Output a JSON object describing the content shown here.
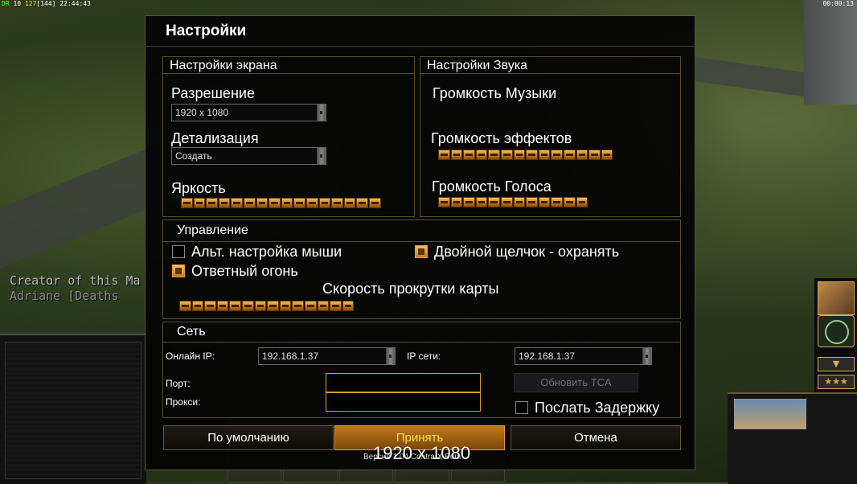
{
  "hud": {
    "fps_label": "DR",
    "fps_value": "10",
    "frame_value": "127",
    "frame_total": "[144]",
    "clock": "22:44:43",
    "game_timer": "00:00:13"
  },
  "background_text": {
    "line1": "Creator of this Ma",
    "line2": "Adriane [Deaths"
  },
  "dialog": {
    "title": "Настройки",
    "screen": {
      "heading": "Настройки экрана",
      "resolution_label": "Разрешение",
      "resolution_value": "1920 x 1080",
      "detail_label": "Детализация",
      "detail_value": "Создать",
      "brightness_label": "Яркость",
      "brightness_segments": 16
    },
    "sound": {
      "heading": "Настройки Звука",
      "music_label": "Громкость Музыки",
      "music_segments": 0,
      "effects_label": "Громкость эффектов",
      "effects_segments": 14,
      "voice_label": "Громкость Голоса",
      "voice_segments": 12
    },
    "control": {
      "heading": "Управление",
      "alt_mouse_label": "Альт. настройка мыши",
      "alt_mouse_checked": false,
      "double_click_label": "Двойной щелчок - охранять",
      "double_click_checked": true,
      "return_fire_label": "Ответный огонь",
      "return_fire_checked": true,
      "scroll_speed_label": "Скорость прокрутки карты",
      "scroll_speed_segments": 14
    },
    "network": {
      "heading": "Сеть",
      "online_ip_label": "Онлайн IP:",
      "online_ip_value": "192.168.1.37",
      "lan_ip_label": "IP сети:",
      "lan_ip_value": "192.168.1.37",
      "port_label": "Порт:",
      "port_value": "",
      "proxy_label": "Прокси:",
      "proxy_value": "",
      "update_button": "Обновить TCA",
      "send_delay_label": "Послать Задержку",
      "send_delay_checked": false
    },
    "buttons": {
      "defaults": "По умолчанию",
      "accept": "Принять",
      "cancel": "Отмена"
    }
  },
  "overlay": {
    "resolution_text": "1920 x 1080",
    "version_text": "Версия 1.04 Contra X Beta"
  },
  "right_hud": {
    "arrow_button": "▼",
    "stars_button": "★★★"
  },
  "colors": {
    "accent_orange": "#c87a18",
    "accept_text": "#f4e04a",
    "border_gold": "#55502e"
  }
}
